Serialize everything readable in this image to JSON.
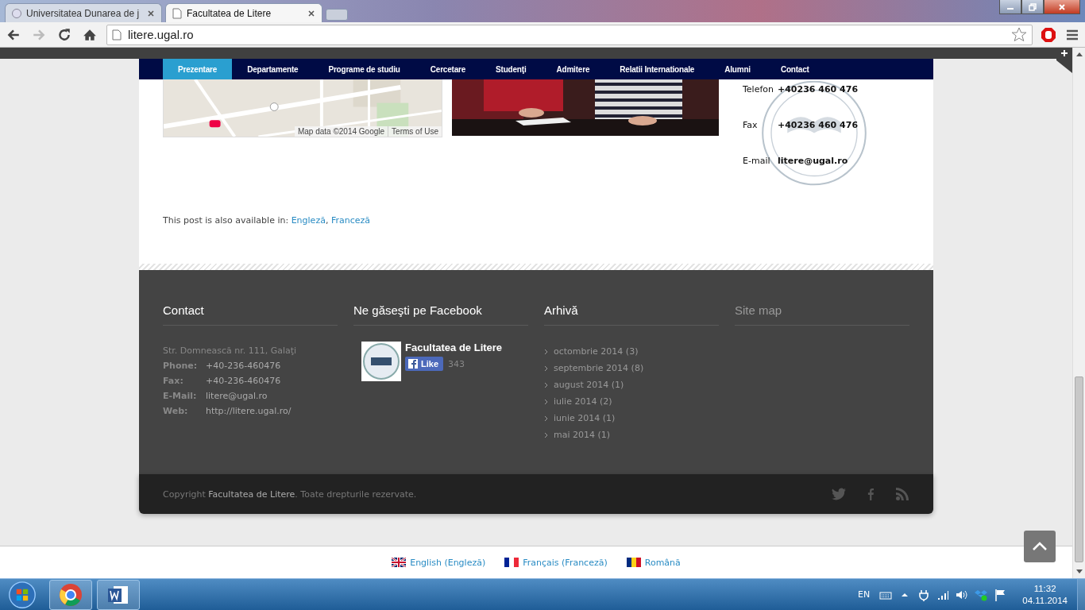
{
  "browser": {
    "tabs": [
      {
        "title": "Universitatea Dunarea de j",
        "selected": false
      },
      {
        "title": "Facultatea de Litere",
        "selected": true
      }
    ],
    "address": "litere.ugal.ro"
  },
  "nav": [
    {
      "label": "Prezentare",
      "selected": true
    },
    {
      "label": "Departamente",
      "selected": false
    },
    {
      "label": "Programe de studiu",
      "selected": false
    },
    {
      "label": "Cercetare",
      "selected": false
    },
    {
      "label": "Studenţi",
      "selected": false
    },
    {
      "label": "Admitere",
      "selected": false
    },
    {
      "label": "Relatii Internationale",
      "selected": false
    },
    {
      "label": "Alumni",
      "selected": false
    },
    {
      "label": "Contact",
      "selected": false
    }
  ],
  "map": {
    "kind": "picture",
    "attribution": "Map data ©2014 Google",
    "terms": "Terms of Use"
  },
  "contact_card": [
    {
      "label": "Telefon",
      "value": "+40236 460 476"
    },
    {
      "label": "Fax",
      "value": "+40236 460 476"
    },
    {
      "label": "E-mail",
      "value": "litere@ugal.ro"
    }
  ],
  "post_languages": {
    "text": "This post is also available in:",
    "links": [
      "Engleză",
      "Franceză"
    ],
    "separator": ","
  },
  "footer": {
    "contact": {
      "title": "Contact",
      "address": "Str. Domnească nr. 111, Galaţi",
      "rows": [
        {
          "label": "Phone:",
          "value": "+40-236-460476"
        },
        {
          "label": "Fax:",
          "value": "+40-236-460476"
        },
        {
          "label": "E-Mail:",
          "value": "litere@ugal.ro"
        },
        {
          "label": "Web:",
          "value": "http://litere.ugal.ro/"
        }
      ]
    },
    "facebook": {
      "title": "Ne găseşti pe Facebook",
      "page": "Facultatea de Litere",
      "like": "Like",
      "count": "343"
    },
    "archive": {
      "title": "Arhivă",
      "items": [
        "octombrie 2014 (3)",
        "septembrie 2014 (8)",
        "august 2014 (1)",
        "iulie 2014 (2)",
        "iunie 2014 (1)",
        "mai 2014 (1)"
      ]
    },
    "sitemap": {
      "title": "Site map"
    }
  },
  "copyright": "Copyright **Facultatea de Litere**. Toate drepturile rezervate.",
  "languages": [
    {
      "label": "English (Engleză)",
      "kind": "uk"
    },
    {
      "label": "Français (Franceză)",
      "kind": "fr"
    },
    {
      "label": "Română",
      "kind": "ro"
    }
  ],
  "taskbar": {
    "language": "EN",
    "time": "11:32",
    "date": "04.11.2014"
  }
}
